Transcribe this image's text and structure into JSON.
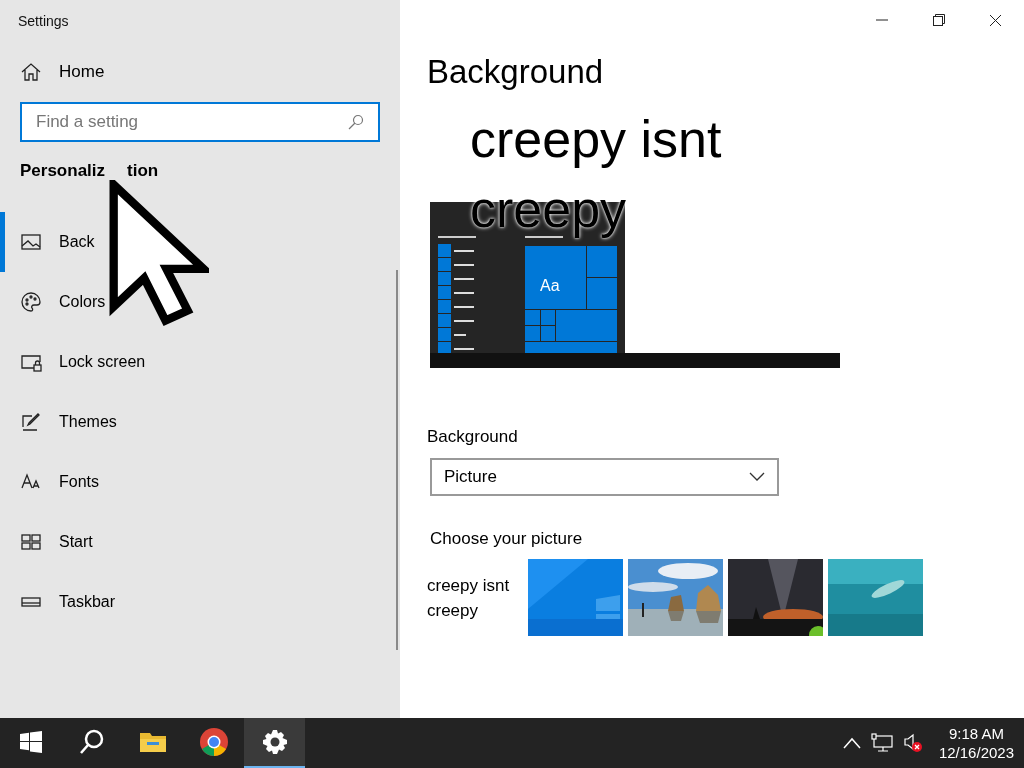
{
  "window": {
    "title": "Settings"
  },
  "sidebar": {
    "home": "Home",
    "search": {
      "placeholder": "Find a setting"
    },
    "section_parts": [
      "Personaliz",
      "tion"
    ],
    "items": [
      {
        "label": "Back",
        "selected": true
      },
      {
        "label": "Colors",
        "selected": false
      },
      {
        "label": "Lock screen",
        "selected": false
      },
      {
        "label": "Themes",
        "selected": false
      },
      {
        "label": "Fonts",
        "selected": false
      },
      {
        "label": "Start",
        "selected": false
      },
      {
        "label": "Taskbar",
        "selected": false
      }
    ]
  },
  "main": {
    "title": "Background",
    "preview": {
      "wallpaper_lines": [
        "creepy isnt",
        "creepy"
      ],
      "tile_label": "Aa"
    },
    "background_label": "Background",
    "background_value": "Picture",
    "choose_label": "Choose your picture",
    "thumbnails": [
      {
        "kind": "text",
        "lines": [
          "creepy isnt",
          "creepy"
        ]
      },
      {
        "kind": "blue"
      },
      {
        "kind": "beach"
      },
      {
        "kind": "night"
      },
      {
        "kind": "sea"
      }
    ]
  },
  "taskbar": {
    "apps": [
      {
        "selected": false
      },
      {
        "selected": false
      },
      {
        "selected": false
      },
      {
        "selected": false
      },
      {
        "selected": true
      }
    ],
    "time": "9:18 AM",
    "date": "12/16/2023"
  }
}
